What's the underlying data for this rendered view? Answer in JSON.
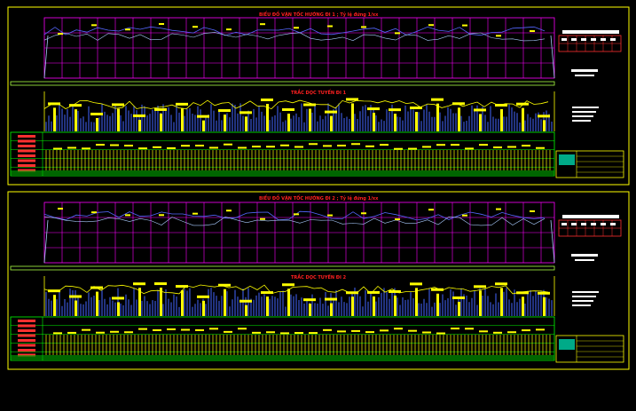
{
  "sheets": [
    {
      "label": "sheet-1",
      "profile_title": "BIỂU ĐỒ VẬN TỐC HƯỚNG ĐI 1 ; Tỷ lệ đứng 1/xx",
      "section_title": "TRẮC DỌC TUYẾN ĐI 1"
    },
    {
      "label": "sheet-2",
      "profile_title": "BIỂU ĐỒ VẬN TỐC HƯỚNG ĐI 2 ; Tỷ lệ đứng 1/xx",
      "section_title": "TRẮC DỌC TUYẾN ĐI 2"
    }
  ],
  "colors": {
    "background": "#000000",
    "frame": "#ffff00",
    "grid": "#ff00ff",
    "speed_line": "#ffffff",
    "profile_line": "#4466ff",
    "labels": "#ffff00",
    "table_lines": "#00ff00",
    "title": "#ff2020"
  }
}
